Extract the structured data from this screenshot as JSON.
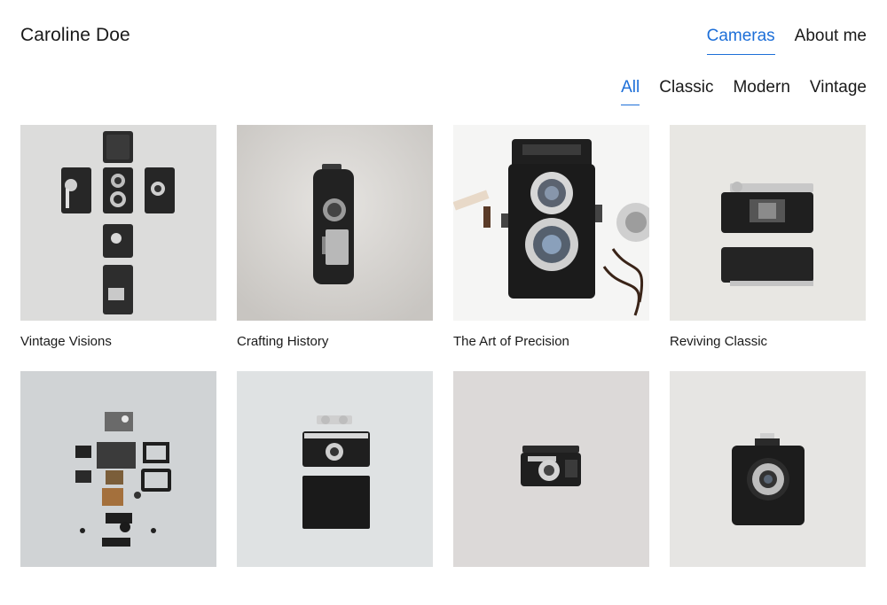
{
  "header": {
    "brand": "Caroline Doe",
    "nav": [
      {
        "label": "Cameras",
        "active": true
      },
      {
        "label": "About me",
        "active": false
      }
    ]
  },
  "filters": [
    {
      "label": "All",
      "active": true
    },
    {
      "label": "Classic",
      "active": false
    },
    {
      "label": "Modern",
      "active": false
    },
    {
      "label": "Vintage",
      "active": false
    }
  ],
  "gallery": [
    {
      "title": "Vintage Visions",
      "bg": "#dcdcdb"
    },
    {
      "title": "Crafting History",
      "bg": "#d9d7d4"
    },
    {
      "title": "The Art of Precision",
      "bg": "#f5f5f4"
    },
    {
      "title": "Reviving Classic",
      "bg": "#e8e7e3"
    },
    {
      "title": "",
      "bg": "#d0d3d5"
    },
    {
      "title": "",
      "bg": "#dfe2e3"
    },
    {
      "title": "",
      "bg": "#dcd9d8"
    },
    {
      "title": "",
      "bg": "#e6e5e3"
    }
  ],
  "colors": {
    "accent": "#1d6fd8",
    "text": "#1a1a1a"
  }
}
